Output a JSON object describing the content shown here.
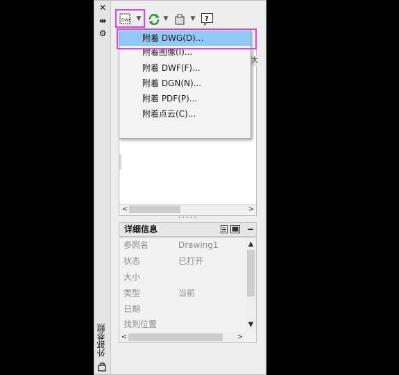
{
  "side": {
    "close_icon": "close-icon",
    "pin_icon": "auto-hide-icon",
    "props_icon": "properties-icon",
    "title": "外部参照"
  },
  "toolbar": {
    "attach_icon": "attach-dwg-icon",
    "refresh_icon": "refresh-icon",
    "change_path_icon": "change-path-icon",
    "help_icon": "help-icon"
  },
  "menu": {
    "items": [
      {
        "label": "附着 DWG(D)..."
      },
      {
        "label": "附着图像(I)..."
      },
      {
        "label": "附着 DWF(F)..."
      },
      {
        "label": "附着 DGN(N)..."
      },
      {
        "label": "附着 PDF(P)..."
      },
      {
        "label": "附着点云(C)..."
      }
    ]
  },
  "details": {
    "title": "详细信息",
    "rows": [
      {
        "label": "参照名",
        "value": "Drawing1"
      },
      {
        "label": "状态",
        "value": "已打开"
      },
      {
        "label": "大小",
        "value": ""
      },
      {
        "label": "类型",
        "value": "当前"
      },
      {
        "label": "日期",
        "value": ""
      },
      {
        "label": "找到位置",
        "value": ""
      }
    ]
  },
  "colors": {
    "highlight_border": "#e040e8",
    "menu_selection": "#90c8f6",
    "refresh_green": "#2a9a2a"
  }
}
